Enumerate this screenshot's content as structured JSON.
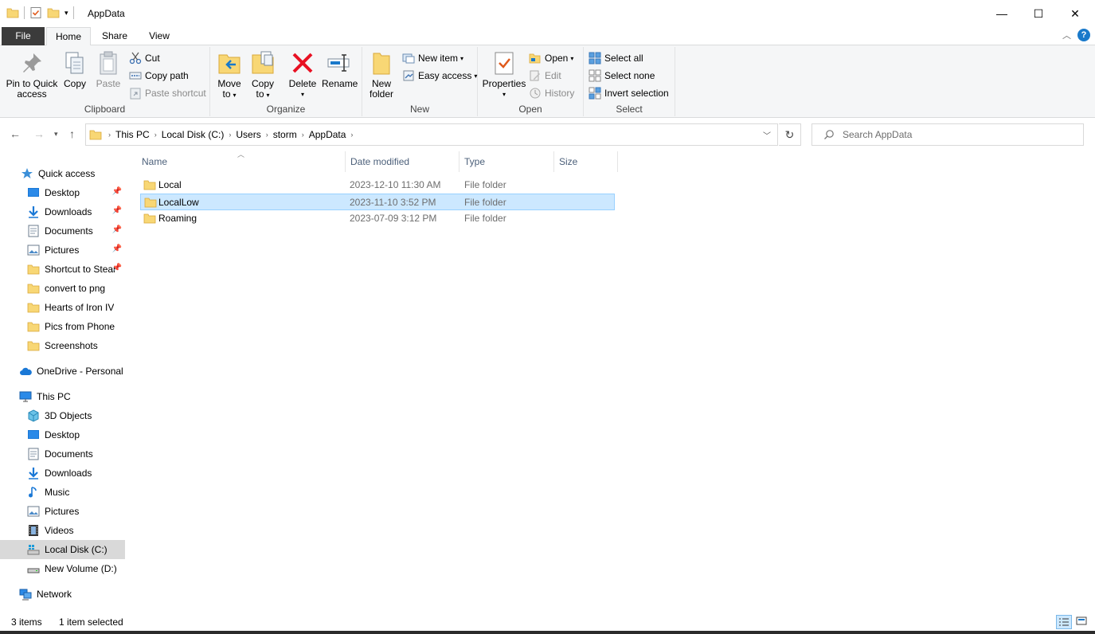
{
  "window": {
    "title": "AppData",
    "minimize": "—",
    "maximize": "☐",
    "close": "✕"
  },
  "ribbon_tabs": [
    {
      "label": "File"
    },
    {
      "label": "Home"
    },
    {
      "label": "Share"
    },
    {
      "label": "View"
    }
  ],
  "help": "?",
  "clipboard": {
    "label": "Clipboard",
    "pin_line1": "Pin to Quick",
    "pin_line2": "access",
    "copy": "Copy",
    "paste": "Paste",
    "cut": "Cut",
    "copy_path": "Copy path",
    "paste_shortcut": "Paste shortcut"
  },
  "organize": {
    "label": "Organize",
    "move_line1": "Move",
    "move_line2": "to",
    "copy_line1": "Copy",
    "copy_line2": "to",
    "delete": "Delete",
    "rename": "Rename"
  },
  "new_group": {
    "label": "New",
    "new_folder_line1": "New",
    "new_folder_line2": "folder",
    "new_item": "New item",
    "easy_access": "Easy access"
  },
  "open_group": {
    "label": "Open",
    "properties": "Properties",
    "open": "Open",
    "edit": "Edit",
    "history": "History"
  },
  "select_group": {
    "label": "Select",
    "select_all": "Select all",
    "select_none": "Select none",
    "invert": "Invert selection"
  },
  "address": {
    "crumbs": [
      "This PC",
      "Local Disk (C:)",
      "Users",
      "storm",
      "AppData"
    ]
  },
  "search": {
    "placeholder": "Search AppData"
  },
  "nav": {
    "quick_access": "Quick access",
    "quick_items": [
      {
        "label": "Desktop",
        "pinned": true
      },
      {
        "label": "Downloads",
        "pinned": true
      },
      {
        "label": "Documents",
        "pinned": true
      },
      {
        "label": "Pictures",
        "pinned": true
      },
      {
        "label": "Shortcut to Stear",
        "pinned": true
      },
      {
        "label": "convert to png",
        "pinned": false
      },
      {
        "label": "Hearts of Iron IV",
        "pinned": false
      },
      {
        "label": "Pics from Phone",
        "pinned": false
      },
      {
        "label": "Screenshots",
        "pinned": false
      }
    ],
    "onedrive": "OneDrive - Personal",
    "this_pc": "This PC",
    "pc_items": [
      {
        "label": "3D Objects"
      },
      {
        "label": "Desktop"
      },
      {
        "label": "Documents"
      },
      {
        "label": "Downloads"
      },
      {
        "label": "Music"
      },
      {
        "label": "Pictures"
      },
      {
        "label": "Videos"
      },
      {
        "label": "Local Disk (C:)"
      },
      {
        "label": "New Volume (D:)"
      }
    ],
    "network": "Network"
  },
  "columns": {
    "name": "Name",
    "date": "Date modified",
    "type": "Type",
    "size": "Size"
  },
  "files": [
    {
      "name": "Local",
      "date": "2023-12-10 11:30 AM",
      "type": "File folder",
      "size": ""
    },
    {
      "name": "LocalLow",
      "date": "2023-11-10 3:52 PM",
      "type": "File folder",
      "size": ""
    },
    {
      "name": "Roaming",
      "date": "2023-07-09 3:12 PM",
      "type": "File folder",
      "size": ""
    }
  ],
  "status": {
    "count": "3 items",
    "selection": "1 item selected"
  },
  "colors": {
    "folder": "#f8d775",
    "selection": "#cce8ff",
    "accent": "#1979ca",
    "delete": "#e81123"
  }
}
